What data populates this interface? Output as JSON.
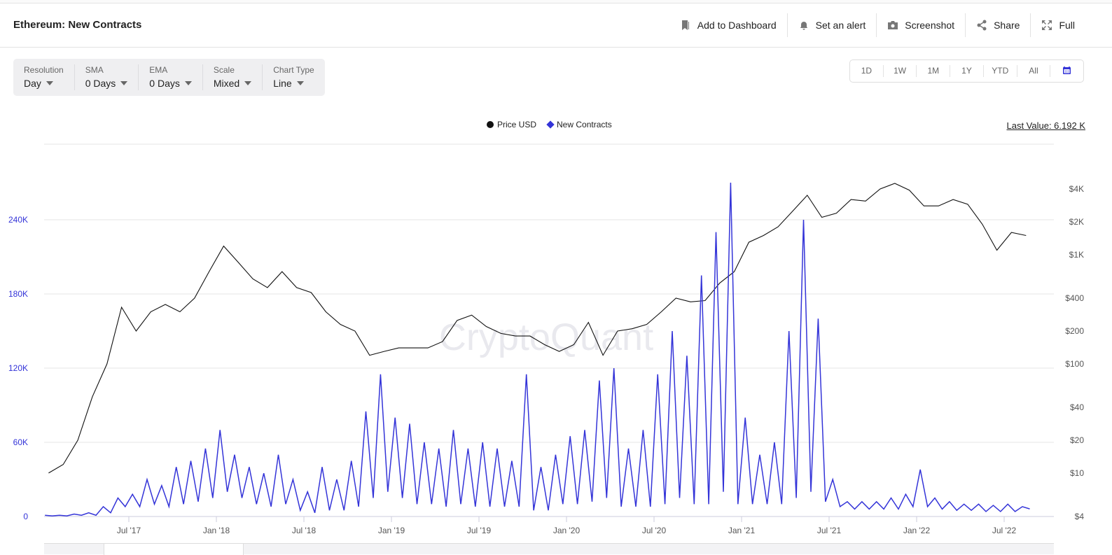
{
  "header": {
    "title": "Ethereum: New Contracts",
    "actions": [
      "Add to Dashboard",
      "Set an alert",
      "Screenshot",
      "Share",
      "Full"
    ]
  },
  "controls": [
    {
      "label": "Resolution",
      "value": "Day"
    },
    {
      "label": "SMA",
      "value": "0 Days"
    },
    {
      "label": "EMA",
      "value": "0 Days"
    },
    {
      "label": "Scale",
      "value": "Mixed"
    },
    {
      "label": "Chart Type",
      "value": "Line"
    }
  ],
  "range_buttons": [
    "1D",
    "1W",
    "1M",
    "1Y",
    "YTD",
    "All"
  ],
  "last_value": "Last Value: 6.192 K",
  "watermark": "CryptoQuant",
  "colors": {
    "contracts": "#3434d8",
    "price": "#111111",
    "left_axis": "#3434d8"
  },
  "chart_data": {
    "type": "line",
    "title": "Ethereum: New Contracts",
    "legend": [
      "Price USD",
      "New Contracts"
    ],
    "legend_position": "top-center",
    "x_ticks": [
      "Jul '17",
      "Jan '18",
      "Jul '18",
      "Jan '19",
      "Jul '19",
      "Jan '20",
      "Jul '20",
      "Jan '21",
      "Jul '21",
      "Jan '22",
      "Jul '22"
    ],
    "x_range": [
      "2017-01",
      "2022-08"
    ],
    "left_axis": {
      "label": "New Contracts",
      "ticks": [
        "0",
        "60K",
        "120K",
        "180K",
        "240K"
      ],
      "tick_values": [
        0,
        60000,
        120000,
        180000,
        240000
      ],
      "ylim": [
        0,
        300000
      ]
    },
    "right_axis": {
      "label": "Price USD",
      "scale": "log",
      "ticks": [
        "$4",
        "$10",
        "$20",
        "$40",
        "$100",
        "$200",
        "$400",
        "$1K",
        "$2K",
        "$4K"
      ],
      "tick_values": [
        4,
        10,
        20,
        40,
        100,
        200,
        400,
        1000,
        2000,
        4000
      ],
      "ylim": [
        4,
        6000
      ]
    },
    "grid": true,
    "series": [
      {
        "name": "Price USD",
        "axis": "right",
        "sampling": "monthly from Jan 2017",
        "values": [
          10,
          12,
          20,
          50,
          100,
          330,
          200,
          300,
          350,
          300,
          400,
          700,
          1200,
          850,
          600,
          500,
          700,
          500,
          450,
          300,
          230,
          200,
          120,
          130,
          140,
          140,
          140,
          160,
          250,
          280,
          220,
          190,
          180,
          180,
          150,
          130,
          150,
          240,
          120,
          200,
          210,
          230,
          300,
          400,
          370,
          380,
          550,
          700,
          1300,
          1500,
          1800,
          2500,
          3500,
          2200,
          2400,
          3200,
          3100,
          4000,
          4500,
          3900,
          2800,
          2800,
          3200,
          2900,
          1900,
          1100,
          1600,
          1500
        ]
      },
      {
        "name": "New Contracts",
        "axis": "left",
        "unit": "K",
        "sampling": "semi-monthly from Jan 2017",
        "values": [
          1,
          0.5,
          1,
          0.5,
          2,
          1,
          3,
          1,
          8,
          3,
          15,
          8,
          18,
          8,
          30,
          10,
          25,
          8,
          40,
          10,
          45,
          12,
          55,
          15,
          70,
          20,
          50,
          15,
          40,
          10,
          35,
          8,
          50,
          10,
          30,
          5,
          20,
          3,
          40,
          5,
          30,
          5,
          45,
          8,
          85,
          15,
          115,
          20,
          80,
          15,
          75,
          10,
          60,
          10,
          55,
          8,
          70,
          10,
          55,
          8,
          60,
          8,
          55,
          8,
          45,
          8,
          115,
          5,
          40,
          5,
          50,
          10,
          65,
          10,
          70,
          12,
          110,
          15,
          120,
          8,
          55,
          8,
          70,
          8,
          115,
          10,
          150,
          15,
          130,
          10,
          195,
          10,
          230,
          20,
          270,
          10,
          80,
          10,
          50,
          10,
          60,
          10,
          150,
          15,
          240,
          20,
          160,
          12,
          30,
          8,
          12,
          6,
          12,
          6,
          12,
          6,
          15,
          6,
          18,
          8,
          38,
          8,
          15,
          6,
          12,
          5,
          10,
          5,
          10,
          4,
          9,
          4,
          10,
          4,
          8,
          6.192
        ]
      }
    ]
  }
}
